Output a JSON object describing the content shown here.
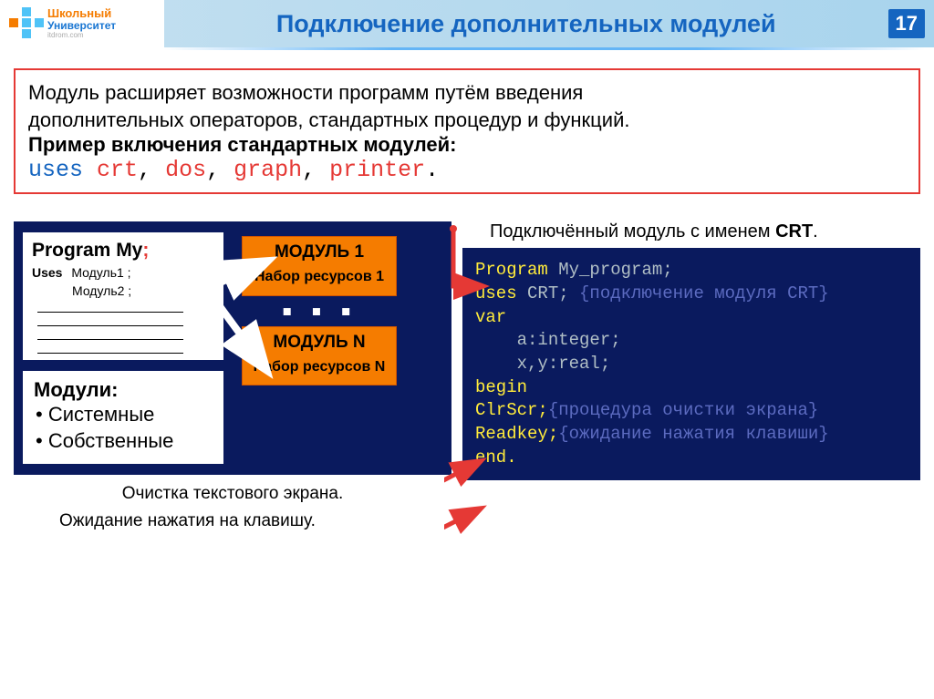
{
  "header": {
    "logo_line1": "Школьный",
    "logo_line2": "Университет",
    "logo_line3": "itdrom.com",
    "title": "Подключение дополнительных модулей",
    "page_number": "17"
  },
  "desc": {
    "line1": "Модуль расширяет возможности программ путём введения",
    "line2": "дополнительных операторов, стандартных процедур и функций.",
    "line3": "Пример включения стандартных модулей:",
    "code_uses": "uses",
    "code_m1": "crt",
    "code_m2": "dos",
    "code_m3": "graph",
    "code_m4": "printer"
  },
  "diagram": {
    "program_title_1": "Program My",
    "program_title_sep": ";",
    "uses_label": "Uses",
    "uses_m1": "Модуль1 ;",
    "uses_m2": "Модуль2 ;",
    "module1_title": "МОДУЛЬ 1",
    "module1_sub": "Набор ресурсов 1",
    "moduleN_title": "МОДУЛЬ N",
    "moduleN_sub": "Набор ресурсов N",
    "ellipsis": "▪ ▪ ▪",
    "mods_title": "Модули:",
    "mods_item1": "• Системные",
    "mods_item2": "• Собственные"
  },
  "right": {
    "crt_caption": "Подключённый модуль с именем ",
    "crt_name": "CRT",
    "crt_dot": ".",
    "code": {
      "l1a": "Program",
      "l1b": " My_program;",
      "l2a": "uses",
      "l2b": " CRT; ",
      "l2c": "{подключение модуля CRT}",
      "l3": "",
      "l4a": "var",
      "l5": "    a:integer;",
      "l6": "    x,y:real;",
      "l7a": "begin",
      "l8": "",
      "l9a": "ClrScr;",
      "l9b": "{процедура очистки экрана}",
      "l10": "",
      "l11a": "Readkey;",
      "l11b": "{ожидание нажатия клавиши}",
      "l12": "",
      "l13a": "end."
    }
  },
  "captions": {
    "c1": "Очистка текстового экрана.",
    "c2": "Ожидание нажатия на клавишу."
  }
}
